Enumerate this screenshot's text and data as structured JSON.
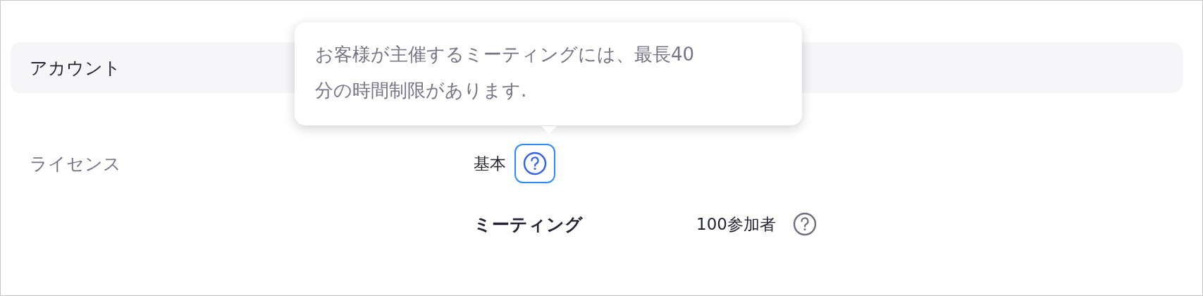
{
  "section": {
    "title": "アカウント"
  },
  "license": {
    "label": "ライセンス",
    "value": "基本",
    "help": {
      "focused": true
    }
  },
  "features": [
    {
      "name": "ミーティング",
      "value": "100参加者",
      "help": {
        "focused": false
      }
    }
  ],
  "tooltip": {
    "text": "お客様が主催するミーティングには、最長40分の時間制限があります."
  }
}
